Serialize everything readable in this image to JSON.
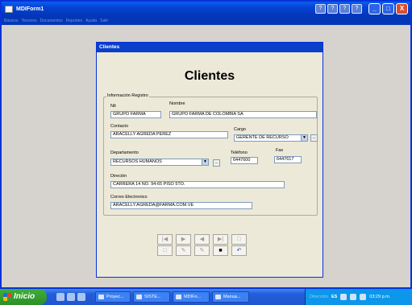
{
  "app": {
    "title": "MDIForm1",
    "menu": [
      "Básicos",
      "Terceros",
      "Documentos",
      "Reportes",
      "Ayuda",
      "Salir"
    ],
    "mdi_icons": [
      "?",
      "?",
      "?",
      "?"
    ],
    "window_buttons": [
      "_",
      "□",
      "X"
    ]
  },
  "child": {
    "title": "Clientes",
    "heading": "Clientes",
    "group_label": "Información Registro",
    "fields": {
      "nit": {
        "label": "Nit",
        "value": "GRUPO FARMA"
      },
      "nombre": {
        "label": "Nombre",
        "value": "GRUPO FARMA DE COLOMBIA SA"
      },
      "contacto": {
        "label": "Contacto",
        "value": "ARACELLY AGREDA PEREZ"
      },
      "cargo": {
        "label": "Cargo",
        "value": "GERENTE DE RECURSO"
      },
      "departamento": {
        "label": "Departamento",
        "value": "RECURSOS HUMANOS"
      },
      "telefono": {
        "label": "Teléfono",
        "value": "6447600"
      },
      "fax": {
        "label": "Fax",
        "value": "6447617"
      },
      "direccion": {
        "label": "Direción",
        "value": "CARRERA 14 NO. 94-65 PISO 5TO."
      },
      "correo": {
        "label": "Correo Electronico",
        "value": "ARACELLY.AGREDA@FARMA.COM.VE"
      }
    },
    "ellipsis": "...",
    "nav_row1": [
      "|◀",
      "▶",
      "◀",
      "▶|",
      "□"
    ],
    "nav_row2": [
      "□",
      "✎",
      "✎",
      "■",
      "↶"
    ]
  },
  "taskbar": {
    "start": "Inicio",
    "tasks": [
      "Proyec...",
      "SISTE...",
      "MDIFo...",
      "Manua..."
    ],
    "tray_label": "Dirección",
    "lang": "ES",
    "clock": "03:29 p.m."
  }
}
